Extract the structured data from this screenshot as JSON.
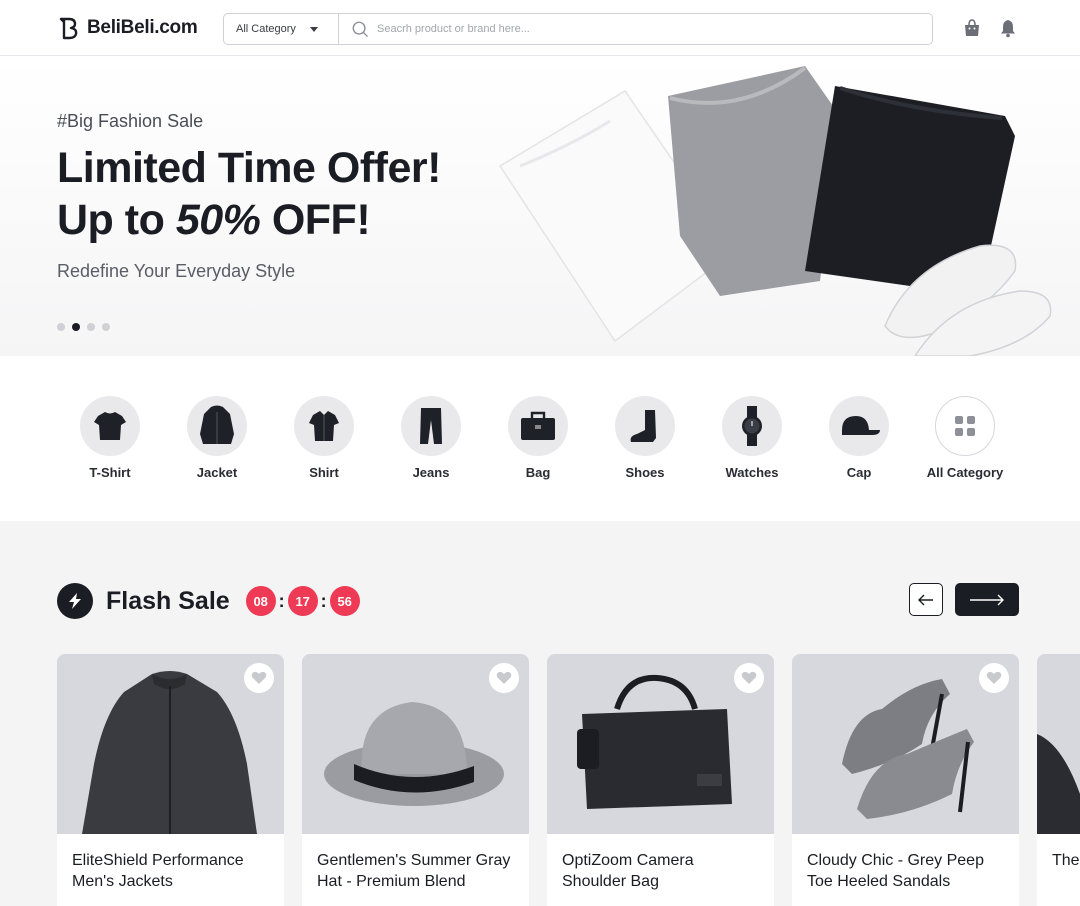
{
  "header": {
    "logo_text": "BeliBeli.com",
    "category_select": "All Category",
    "search_placeholder": "Seacrh product or brand here...",
    "icons": [
      "shopping-bag-icon",
      "bell-icon"
    ]
  },
  "hero": {
    "tag": "#Big Fashion Sale",
    "title_line1": "Limited Time Offer!",
    "title_line2_prefix": "Up to ",
    "title_line2_emph": "50%",
    "title_line2_suffix": " OFF!",
    "subtitle": "Redefine Your Everyday Style",
    "slides": 4,
    "active_slide": 2
  },
  "categories": [
    {
      "label": "T-Shirt",
      "icon": "tshirt-icon"
    },
    {
      "label": "Jacket",
      "icon": "jacket-icon"
    },
    {
      "label": "Shirt",
      "icon": "shirt-icon"
    },
    {
      "label": "Jeans",
      "icon": "jeans-icon"
    },
    {
      "label": "Bag",
      "icon": "bag-icon"
    },
    {
      "label": "Shoes",
      "icon": "shoes-icon"
    },
    {
      "label": "Watches",
      "icon": "watch-icon"
    },
    {
      "label": "Cap",
      "icon": "cap-icon"
    },
    {
      "label": "All Category",
      "icon": "grid-icon"
    }
  ],
  "flash_sale": {
    "title": "Flash Sale",
    "timer": {
      "hours": "08",
      "minutes": "17",
      "seconds": "56"
    },
    "products": [
      {
        "name": "EliteShield Performance Men's Jackets"
      },
      {
        "name": "Gentlemen's Summer Gray Hat - Premium Blend"
      },
      {
        "name": "OptiZoom Camera Shoulder Bag"
      },
      {
        "name": "Cloudy Chic - Grey Peep Toe Heeled Sandals"
      },
      {
        "name": "The... Pre..."
      }
    ]
  },
  "colors": {
    "primary": "#1b1d24",
    "accent_timer": "#ee3a55",
    "section_bg": "#f4f4f5"
  }
}
